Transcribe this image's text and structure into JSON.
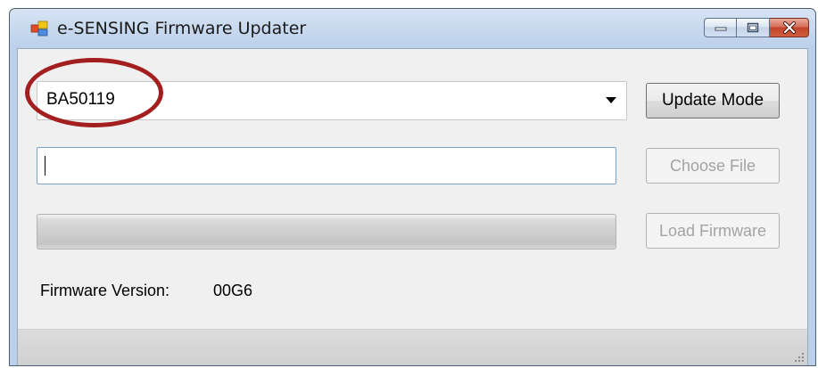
{
  "window": {
    "title": "e-SENSING Firmware Updater"
  },
  "device_combo": {
    "selected": "BA50119"
  },
  "buttons": {
    "update_mode": "Update Mode",
    "choose_file": "Choose File",
    "load_firmware": "Load Firmware"
  },
  "file_path": {
    "value": "",
    "placeholder": ""
  },
  "progress": {
    "fraction": 0
  },
  "firmware": {
    "label": "Firmware Version:",
    "value": "00G6"
  },
  "colors": {
    "annotation_circle": "#a31f1f",
    "close_button": "#c1432b",
    "textfield_border": "#7da2ce"
  },
  "icons": {
    "app": "app-window-icon",
    "minimize": "minimize-icon",
    "maximize": "maximize-icon",
    "close": "close-icon",
    "dropdown": "dropdown-arrow-icon",
    "grip": "resize-grip-icon"
  }
}
